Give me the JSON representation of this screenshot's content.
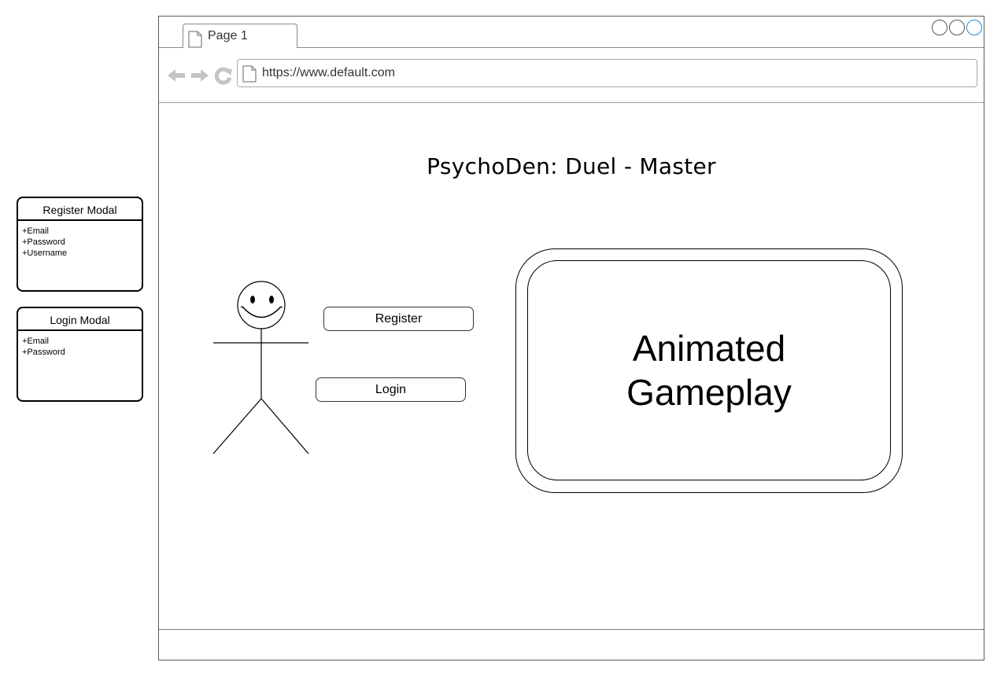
{
  "browser": {
    "tab_label": "Page 1",
    "url": "https://www.default.com",
    "accent_color": "#1e90d6"
  },
  "page": {
    "title": "PsychoDen: Duel - Master",
    "register_label": "Register",
    "login_label": "Login",
    "animation_label": "Animated\nGameplay"
  },
  "register_modal": {
    "title": "Register Modal",
    "fields": [
      "+Email",
      "+Password",
      "+Username"
    ]
  },
  "login_modal": {
    "title": "Login Modal",
    "fields": [
      "+Email",
      "+Password"
    ]
  },
  "icons": [
    "page-icon",
    "back-arrow-icon",
    "forward-arrow-icon",
    "refresh-icon",
    "smiley-user-icon"
  ]
}
